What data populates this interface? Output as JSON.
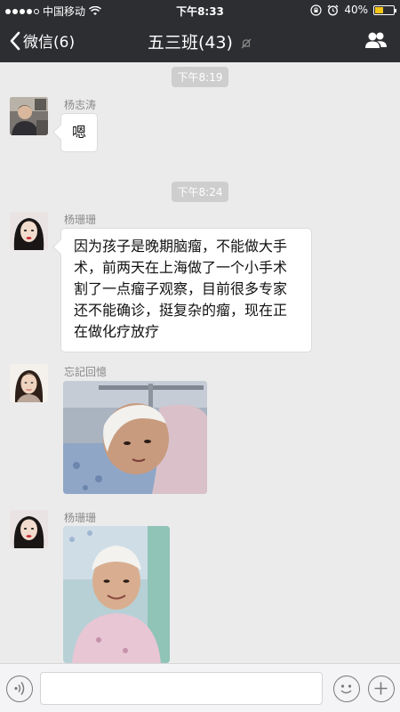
{
  "status_bar": {
    "carrier": "中国移动",
    "time": "下午8:33",
    "battery": "40%",
    "battery_level": 0.4
  },
  "nav": {
    "back_label": "微信(6)",
    "title": "五三班(43)"
  },
  "messages": [
    {
      "type": "timestamp",
      "text": "下午8:19"
    },
    {
      "type": "text",
      "sender": "杨志涛",
      "text": "嗯"
    },
    {
      "type": "timestamp",
      "text": "下午8:24"
    },
    {
      "type": "text",
      "sender": "杨珊珊",
      "lines": [
        "因为孩子是晚期脑瘤，不能做大手",
        "术，前两天在上海做了一个小手术",
        "割了一点瘤子观察，目前很多专家",
        "还不能确诊，挺复杂的瘤，现在正",
        "在做化疗放疗"
      ]
    },
    {
      "type": "image",
      "sender": "忘記回憶",
      "image": "child-in-hospital-bed-photo"
    },
    {
      "type": "image",
      "sender": "杨珊珊",
      "image": "child-with-head-bandage-photo"
    }
  ],
  "icons": {
    "back": "chevron-left-icon",
    "mute": "mute-bell-icon",
    "contacts": "group-contacts-icon",
    "voice": "voice-icon",
    "emoji": "emoji-icon",
    "add": "plus-icon",
    "wifi": "wifi-icon",
    "lock_rotation": "rotation-lock-icon",
    "alarm": "alarm-icon"
  },
  "colors": {
    "nav_bg": "#2d2e32",
    "chat_bg": "#ebebeb",
    "bubble_bg": "#ffffff",
    "timestamp_bg": "#cecece",
    "battery_fill": "#f5c518"
  }
}
